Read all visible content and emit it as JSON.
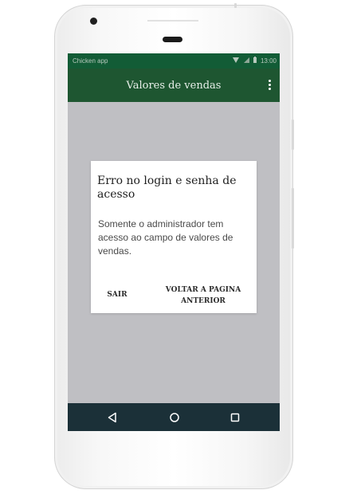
{
  "statusbar": {
    "app_name": "Chicken app",
    "time": "13:00",
    "wifi_icon": "wifi-icon",
    "signal_icon": "signal-icon",
    "battery_icon": "battery-icon"
  },
  "appbar": {
    "title": "Valores de vendas",
    "menu_icon": "more-vert-icon"
  },
  "dialog": {
    "title": "Erro no login e senha de acesso",
    "message": "Somente o administrador tem acesso ao campo de valores de vendas.",
    "buttons": [
      "SAIR",
      "VOLTAR A PAGINA ANTERIOR"
    ]
  },
  "navbar": {
    "back_icon": "back-icon",
    "home_icon": "home-icon",
    "recents_icon": "recents-icon"
  },
  "colors": {
    "appbar": "#1e5631",
    "statusbar": "#125c36",
    "navbar": "#1b3038",
    "scrim": "#bfbfc3"
  }
}
